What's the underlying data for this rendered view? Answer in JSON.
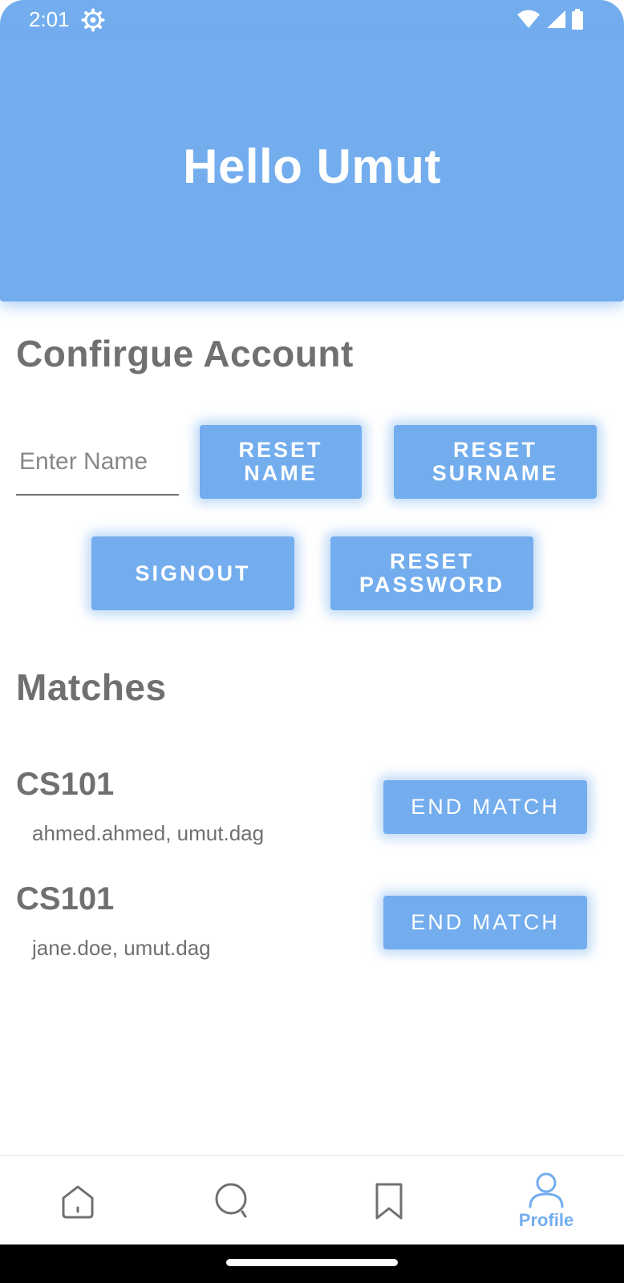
{
  "status_bar": {
    "time": "2:01",
    "icons": [
      "settings-icon",
      "wifi-icon",
      "signal-icon",
      "battery-icon"
    ]
  },
  "header": {
    "title": "Hello Umut"
  },
  "account": {
    "title": "Confirgue Account",
    "name_placeholder": "Enter Name",
    "name_value": "",
    "reset_name_label": "RESET NAME",
    "reset_surname_label": "RESET SURNAME",
    "signout_label": "SIGNOUT",
    "reset_password_label": "RESET PASSWORD"
  },
  "matches": {
    "title": "Matches",
    "items": [
      {
        "course": "CS101",
        "users": "ahmed.ahmed, umut.dag",
        "action_label": "END MATCH"
      },
      {
        "course": "CS101",
        "users": "jane.doe, umut.dag",
        "action_label": "END MATCH"
      }
    ]
  },
  "nav": {
    "items": [
      {
        "icon": "home-icon",
        "label": ""
      },
      {
        "icon": "search-icon",
        "label": ""
      },
      {
        "icon": "bookmark-icon",
        "label": ""
      },
      {
        "icon": "profile-icon",
        "label": "Profile",
        "active": true
      }
    ]
  },
  "colors": {
    "primary": "#73ADEE",
    "text": "#707070",
    "nav_inactive": "#707070"
  }
}
